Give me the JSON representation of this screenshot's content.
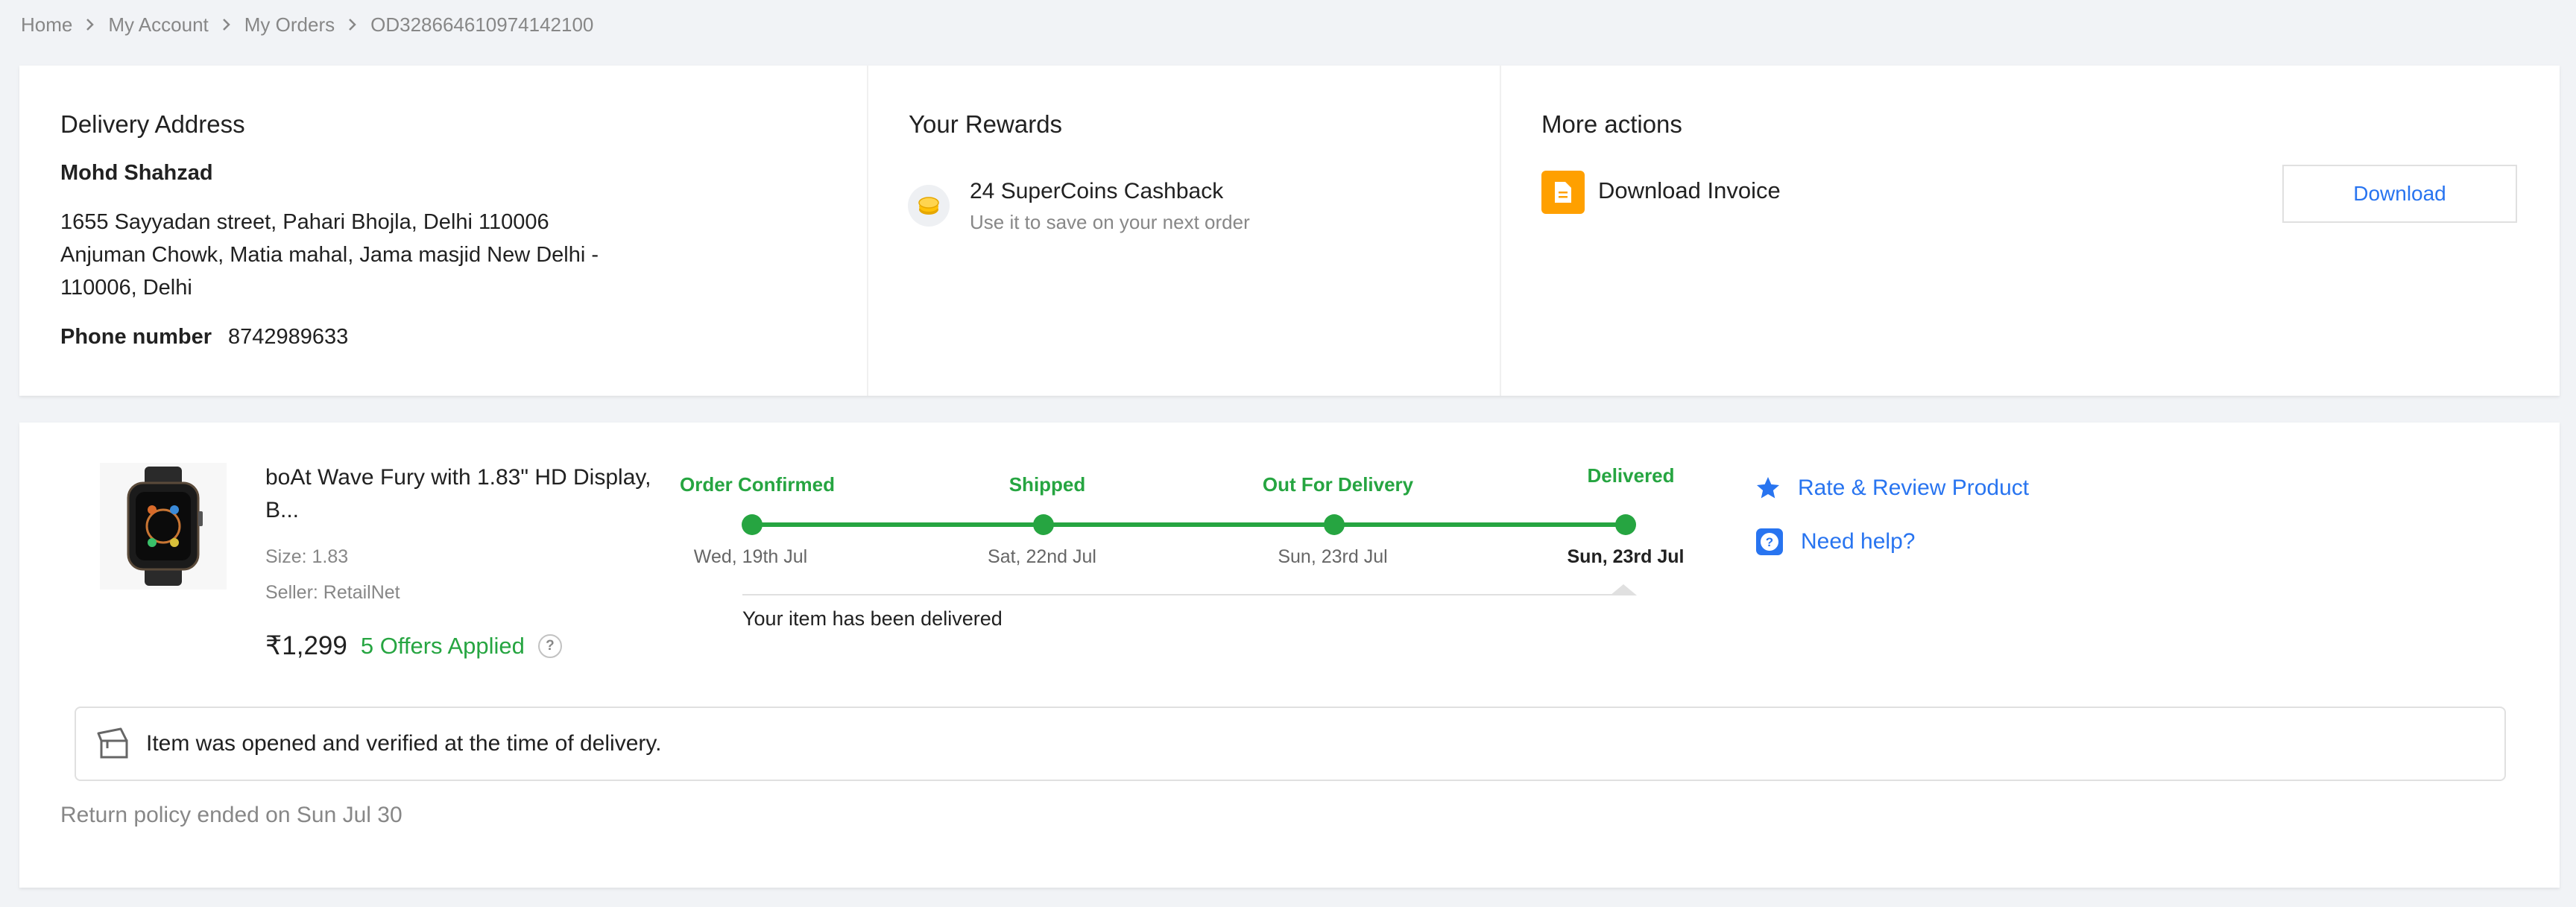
{
  "breadcrumb": [
    "Home",
    "My Account",
    "My Orders",
    "OD328664610974142100"
  ],
  "address": {
    "title": "Delivery Address",
    "name": "Mohd Shahzad",
    "lines": [
      "1655 Sayyadan street, Pahari Bhojla, Delhi 110006",
      "Anjuman Chowk, Matia mahal, Jama masjid New Delhi -",
      "110006, Delhi"
    ],
    "phone_label": "Phone number",
    "phone": "8742989633"
  },
  "rewards": {
    "title": "Your Rewards",
    "cashback": "24 SuperCoins Cashback",
    "subtitle": "Use it to save on your next order"
  },
  "actions": {
    "title": "More actions",
    "invoice_label": "Download Invoice",
    "download_button": "Download"
  },
  "product": {
    "title_lines": [
      "boAt Wave Fury with 1.83\" HD Display,",
      "B..."
    ],
    "size": "Size: 1.83",
    "seller": "Seller: RetailNet",
    "price": "₹1,299",
    "offers": "5 Offers Applied",
    "help_glyph": "?"
  },
  "tracker": {
    "stages": [
      {
        "label": "Order Confirmed",
        "date": "Wed, 19th Jul"
      },
      {
        "label": "Shipped",
        "date": "Sat, 22nd Jul"
      },
      {
        "label": "Out For Delivery",
        "date": "Sun, 23rd Jul"
      },
      {
        "label": "Delivered",
        "date": "Sun, 23rd Jul"
      }
    ],
    "status_note": "Your item has been delivered"
  },
  "side_actions": {
    "rate": "Rate & Review Product",
    "help": "Need help?"
  },
  "verification": "Item was opened and verified at the time of delivery.",
  "return_policy": "Return policy ended on Sun Jul 30",
  "icons": {
    "breadcrumb_separator": "chevron-right-icon",
    "rewards": "supercoin-icon",
    "invoice": "document-icon",
    "rate": "star-icon",
    "help": "question-icon",
    "verification": "open-box-icon"
  },
  "colors": {
    "primary": "#2874f0",
    "success": "#26a541",
    "invoice_bg": "#ffa000",
    "muted": "#878787",
    "background": "#f1f3f6"
  }
}
